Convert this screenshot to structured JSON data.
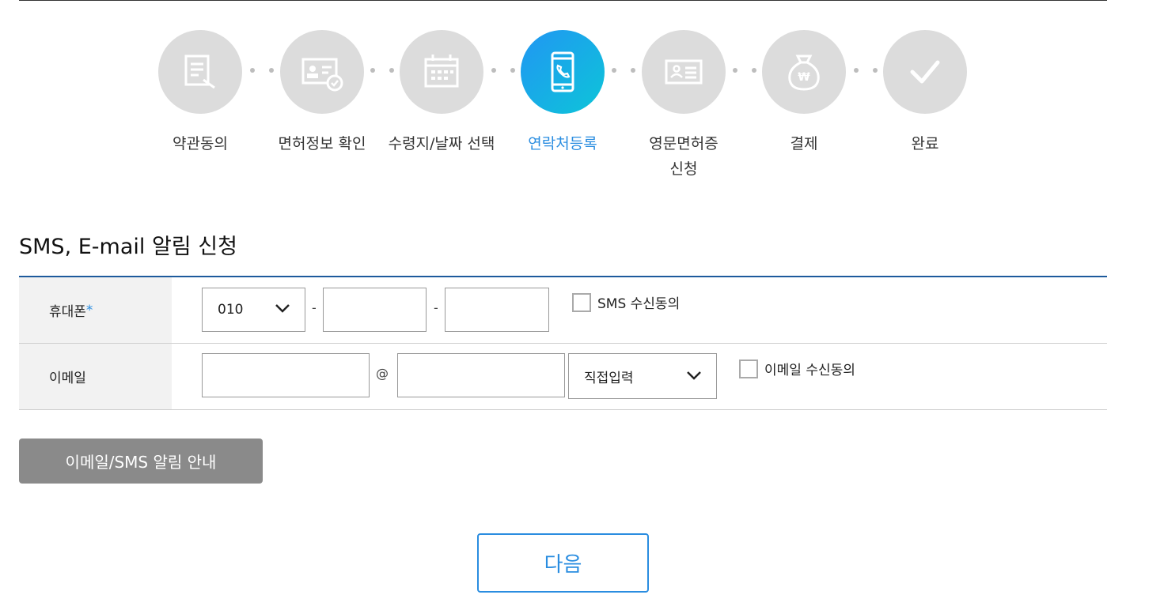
{
  "steps": [
    {
      "label": "약관동의",
      "icon": "document-sign-icon",
      "active": false
    },
    {
      "label": "면허정보 확인",
      "icon": "id-card-check-icon",
      "active": false
    },
    {
      "label": "수령지/날짜 선택",
      "icon": "calendar-icon",
      "active": false
    },
    {
      "label": "연락처등록",
      "icon": "phone-icon",
      "active": true
    },
    {
      "label": "영문면허증\n신청",
      "icon": "license-card-icon",
      "active": false
    },
    {
      "label": "결제",
      "icon": "money-bag-icon",
      "active": false
    },
    {
      "label": "완료",
      "icon": "check-icon",
      "active": false
    }
  ],
  "section_title": "SMS, E-mail 알림 신청",
  "phone": {
    "label": "휴대폰",
    "required_mark": "*",
    "prefix_value": "010",
    "separator": "-",
    "middle_value": "",
    "last_value": "",
    "consent_label": "SMS 수신동의"
  },
  "email": {
    "label": "이메일",
    "id_value": "",
    "at_symbol": "@",
    "domain_value": "",
    "domain_select": "직접입력",
    "consent_label": "이메일 수신동의"
  },
  "guide_button": "이메일/SMS 알림 안내",
  "next_button": "다음",
  "colors": {
    "accent": "#2a8de0",
    "table_border": "#1d5a9c",
    "inactive_step": "#dcdcdc",
    "guide_button_bg": "#8a8a8a"
  }
}
